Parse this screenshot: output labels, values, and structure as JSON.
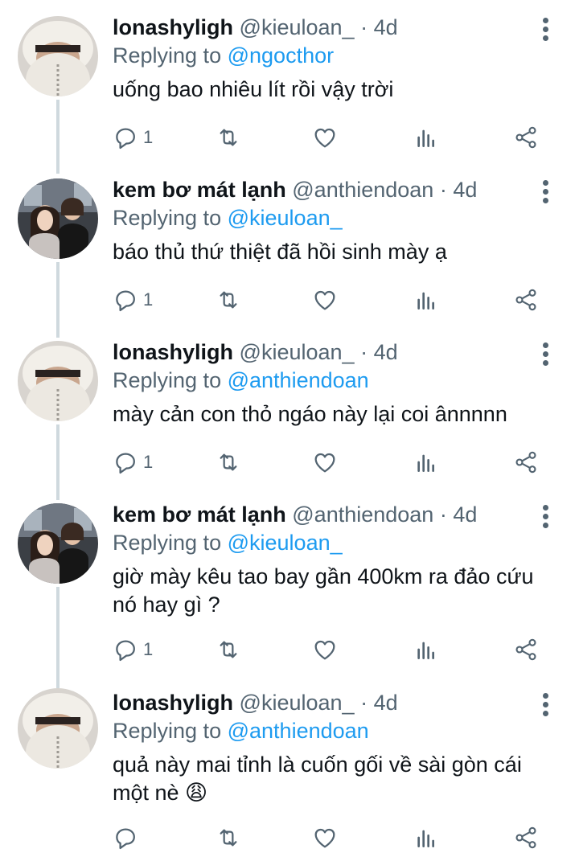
{
  "tweets": [
    {
      "name": "lonashyligh",
      "handle": "@kieuloan_",
      "separator": "·",
      "time": "4d",
      "replying_prefix": "Replying to",
      "replying_to": "@ngocthor",
      "text": "uống bao nhiêu lít rồi vậy trời",
      "reply_count": "1",
      "avatar": "user-hood-avatar"
    },
    {
      "name": "kem bơ mát lạnh",
      "handle": "@anthiendoan",
      "separator": "·",
      "time": "4d",
      "replying_prefix": "Replying to",
      "replying_to": "@kieuloan_",
      "text": "báo thủ thứ thiệt đã hồi sinh mày ạ",
      "reply_count": "1",
      "avatar": "two-people-avatar"
    },
    {
      "name": "lonashyligh",
      "handle": "@kieuloan_",
      "separator": "·",
      "time": "4d",
      "replying_prefix": "Replying to",
      "replying_to": "@anthiendoan",
      "text": "mày cản con thỏ ngáo này lại coi ânnnnn",
      "reply_count": "1",
      "avatar": "user-hood-avatar"
    },
    {
      "name": "kem bơ mát lạnh",
      "handle": "@anthiendoan",
      "separator": "·",
      "time": "4d",
      "replying_prefix": "Replying to",
      "replying_to": "@kieuloan_",
      "text": "giờ mày kêu tao bay gần 400km ra đảo cứu nó hay gì ?",
      "reply_count": "1",
      "avatar": "two-people-avatar"
    },
    {
      "name": "lonashyligh",
      "handle": "@kieuloan_",
      "separator": "·",
      "time": "4d",
      "replying_prefix": "Replying to",
      "replying_to": "@anthiendoan",
      "text": "quả này mai tỉnh là cuốn gối về sài gòn cái một nè 😩",
      "reply_count": "",
      "avatar": "user-hood-avatar"
    }
  ],
  "icons": {
    "reply": "reply-icon",
    "retweet": "retweet-icon",
    "like": "heart-icon",
    "analytics": "analytics-icon",
    "share": "share-icon",
    "more": "more-options-icon"
  },
  "colors": {
    "link": "#1d9bf0",
    "secondary_text": "#536471",
    "thread_line": "#cfd9de"
  }
}
